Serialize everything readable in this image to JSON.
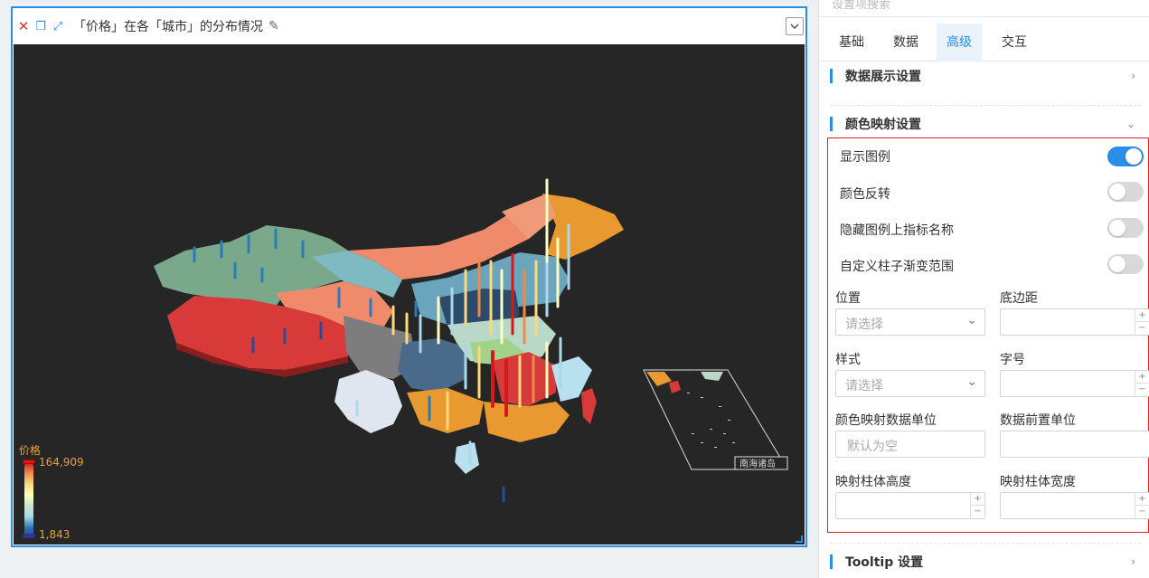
{
  "widget": {
    "title": "「价格」在各「城市」的分布情况",
    "legend": {
      "title": "价格",
      "max": "164,909",
      "min": "1,843"
    },
    "inset_label": "南海诸岛"
  },
  "panel": {
    "search_placeholder": "设置项搜索",
    "tabs": [
      {
        "label": "基础",
        "active": false
      },
      {
        "label": "数据",
        "active": false
      },
      {
        "label": "高级",
        "active": true
      },
      {
        "label": "交互",
        "active": false
      }
    ],
    "sections": {
      "data_display": "数据展示设置",
      "color_map": "颜色映射设置",
      "tooltip": "Tooltip 设置"
    },
    "toggles": [
      {
        "label": "显示图例",
        "on": true
      },
      {
        "label": "颜色反转",
        "on": false
      },
      {
        "label": "隐藏图例上指标名称",
        "on": false
      },
      {
        "label": "自定义柱子渐变范围",
        "on": false
      }
    ],
    "fields": {
      "position_label": "位置",
      "position_placeholder": "请选择",
      "bottom_margin_label": "底边距",
      "style_label": "样式",
      "style_placeholder": "请选择",
      "font_size_label": "字号",
      "unit_label": "颜色映射数据单位",
      "unit_placeholder": "默认为空",
      "prefix_unit_label": "数据前置单位",
      "bar_height_label": "映射柱体高度",
      "bar_width_label": "映射柱体宽度"
    }
  },
  "colors": {
    "accent": "#2a8ee8",
    "highlight_border": "#e02020",
    "map_bg": "#262626"
  }
}
